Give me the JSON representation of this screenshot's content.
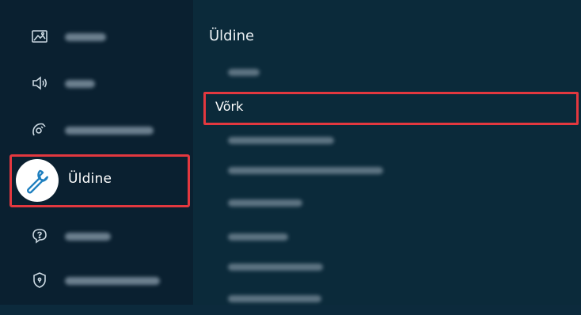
{
  "sidebar": {
    "items": [
      {
        "icon": "picture-icon"
      },
      {
        "icon": "sound-icon"
      },
      {
        "icon": "broadcasting-icon"
      },
      {
        "icon": "wrench-icon",
        "label": "Üldine",
        "selected": true
      },
      {
        "icon": "support-icon"
      },
      {
        "icon": "privacy-shield-icon"
      }
    ]
  },
  "main": {
    "title": "Üldine",
    "menu": {
      "selected_label": "Võrk"
    }
  },
  "colors": {
    "background": "#0b2a3a",
    "sidebar": "#0a2030",
    "highlight": "#e3383f",
    "text": "#ffffff"
  }
}
